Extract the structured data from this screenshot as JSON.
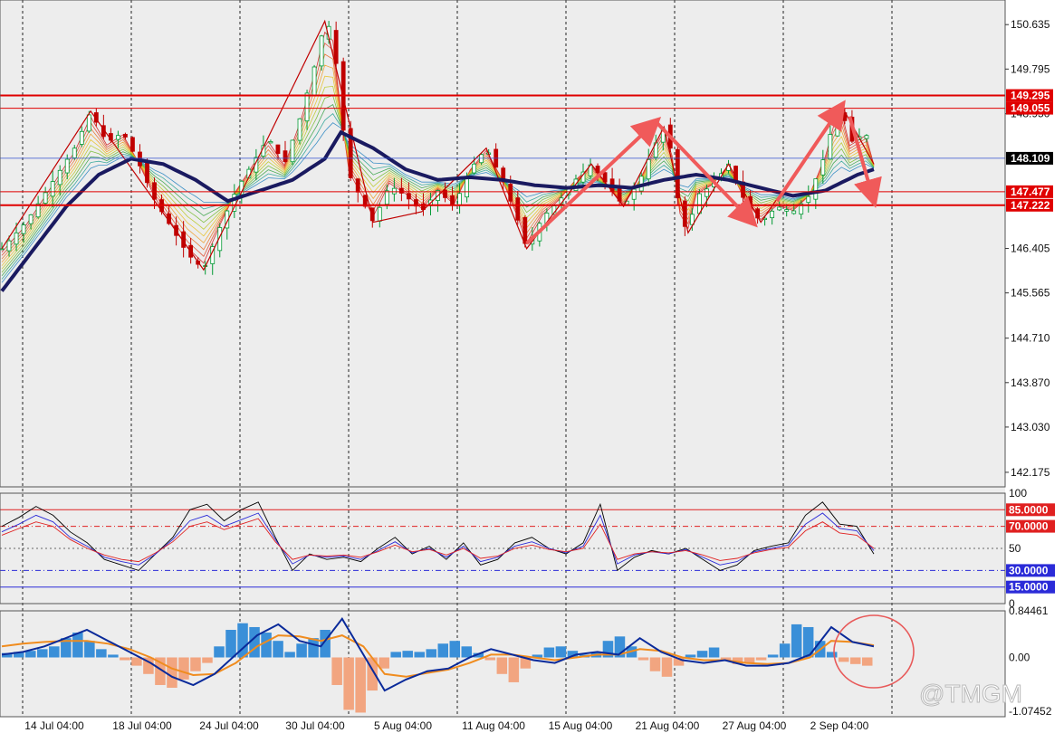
{
  "colors": {
    "background": "#ededed",
    "panel_bg": "#ffffff",
    "candle_red": "#c00000",
    "candle_green": "#009933",
    "ma_slow": "#1a1a60",
    "resistance": "#e00000",
    "annotation_arrow": "#f05a5a",
    "current_price_tag": "#000000",
    "macd_pos": "#3a8fd8",
    "macd_neg": "#f2a580",
    "macd_line": "#0a2a9a",
    "signal_line": "#f08c1e",
    "rsi_black": "#000000",
    "rsi_blue": "#2b2bd8",
    "rsi_red": "#e02020"
  },
  "chart_data": [
    {
      "type": "candlestick",
      "title": "",
      "x_labels": [
        "14 Jul 04:00",
        "18 Jul 04:00",
        "24 Jul 04:00",
        "30 Jul 04:00",
        "5 Aug 04:00",
        "11 Aug 04:00",
        "15 Aug 04:00",
        "21 Aug 04:00",
        "27 Aug 04:00",
        "2 Sep 04:00"
      ],
      "y_ticks": [
        "150.635",
        "149.795",
        "148.950",
        "146.405",
        "145.565",
        "144.710",
        "143.870",
        "143.030",
        "142.175"
      ],
      "ylim": [
        141.9,
        151.1
      ],
      "price_path": [
        {
          "x": 0,
          "y": 146.4
        },
        {
          "x": 3,
          "y": 146.9
        },
        {
          "x": 6,
          "y": 147.6
        },
        {
          "x": 9,
          "y": 148.3
        },
        {
          "x": 11,
          "y": 149.0
        },
        {
          "x": 13,
          "y": 148.4
        },
        {
          "x": 15,
          "y": 148.6
        },
        {
          "x": 17,
          "y": 148.0
        },
        {
          "x": 19,
          "y": 147.3
        },
        {
          "x": 21,
          "y": 146.8
        },
        {
          "x": 23,
          "y": 146.3
        },
        {
          "x": 25,
          "y": 146.0
        },
        {
          "x": 27,
          "y": 146.8
        },
        {
          "x": 29,
          "y": 147.5
        },
        {
          "x": 31,
          "y": 148.0
        },
        {
          "x": 33,
          "y": 148.5
        },
        {
          "x": 35,
          "y": 148.0
        },
        {
          "x": 37,
          "y": 148.9
        },
        {
          "x": 39,
          "y": 150.0
        },
        {
          "x": 40,
          "y": 150.7
        },
        {
          "x": 41,
          "y": 150.5
        },
        {
          "x": 42,
          "y": 149.0
        },
        {
          "x": 43,
          "y": 147.8
        },
        {
          "x": 45,
          "y": 147.2
        },
        {
          "x": 46,
          "y": 146.9
        },
        {
          "x": 48,
          "y": 147.6
        },
        {
          "x": 50,
          "y": 147.4
        },
        {
          "x": 52,
          "y": 147.1
        },
        {
          "x": 54,
          "y": 147.5
        },
        {
          "x": 56,
          "y": 147.2
        },
        {
          "x": 58,
          "y": 147.9
        },
        {
          "x": 60,
          "y": 148.3
        },
        {
          "x": 62,
          "y": 147.7
        },
        {
          "x": 64,
          "y": 146.9
        },
        {
          "x": 65,
          "y": 146.4
        },
        {
          "x": 67,
          "y": 147.0
        },
        {
          "x": 69,
          "y": 147.3
        },
        {
          "x": 71,
          "y": 147.7
        },
        {
          "x": 73,
          "y": 148.0
        },
        {
          "x": 75,
          "y": 147.6
        },
        {
          "x": 77,
          "y": 147.2
        },
        {
          "x": 79,
          "y": 147.7
        },
        {
          "x": 81,
          "y": 148.4
        },
        {
          "x": 82,
          "y": 148.7
        },
        {
          "x": 83,
          "y": 148.2
        },
        {
          "x": 84,
          "y": 147.0
        },
        {
          "x": 85,
          "y": 146.7
        },
        {
          "x": 86,
          "y": 147.4
        },
        {
          "x": 88,
          "y": 147.6
        },
        {
          "x": 90,
          "y": 148.0
        },
        {
          "x": 92,
          "y": 147.3
        },
        {
          "x": 94,
          "y": 146.9
        },
        {
          "x": 96,
          "y": 147.2
        },
        {
          "x": 98,
          "y": 147.1
        },
        {
          "x": 100,
          "y": 147.4
        },
        {
          "x": 102,
          "y": 148.2
        },
        {
          "x": 103,
          "y": 148.8
        },
        {
          "x": 104,
          "y": 149.1
        },
        {
          "x": 105,
          "y": 148.4
        },
        {
          "x": 107,
          "y": 148.6
        },
        {
          "x": 108,
          "y": 148.0
        }
      ],
      "moving_average": [
        {
          "x": 0,
          "y": 145.6
        },
        {
          "x": 4,
          "y": 146.4
        },
        {
          "x": 8,
          "y": 147.2
        },
        {
          "x": 12,
          "y": 147.8
        },
        {
          "x": 16,
          "y": 148.1
        },
        {
          "x": 20,
          "y": 148.0
        },
        {
          "x": 24,
          "y": 147.7
        },
        {
          "x": 28,
          "y": 147.3
        },
        {
          "x": 32,
          "y": 147.5
        },
        {
          "x": 36,
          "y": 147.7
        },
        {
          "x": 40,
          "y": 148.1
        },
        {
          "x": 42,
          "y": 148.6
        },
        {
          "x": 46,
          "y": 148.3
        },
        {
          "x": 50,
          "y": 147.9
        },
        {
          "x": 54,
          "y": 147.7
        },
        {
          "x": 58,
          "y": 147.75
        },
        {
          "x": 62,
          "y": 147.7
        },
        {
          "x": 66,
          "y": 147.6
        },
        {
          "x": 70,
          "y": 147.55
        },
        {
          "x": 74,
          "y": 147.6
        },
        {
          "x": 78,
          "y": 147.55
        },
        {
          "x": 82,
          "y": 147.7
        },
        {
          "x": 86,
          "y": 147.8
        },
        {
          "x": 90,
          "y": 147.7
        },
        {
          "x": 94,
          "y": 147.55
        },
        {
          "x": 98,
          "y": 147.4
        },
        {
          "x": 102,
          "y": 147.5
        },
        {
          "x": 106,
          "y": 147.8
        },
        {
          "x": 108,
          "y": 147.9
        }
      ],
      "horizontal_levels": [
        {
          "price": 149.295,
          "label": "149.295",
          "style": "thick"
        },
        {
          "price": 149.055,
          "label": "149.055",
          "style": "thin"
        },
        {
          "price": 147.477,
          "label": "147.477",
          "style": "thin"
        },
        {
          "price": 147.222,
          "label": "147.222",
          "style": "thick"
        }
      ],
      "current_price": {
        "price": 148.109,
        "label": "148.109"
      },
      "annotations": [
        {
          "from": [
            65,
            146.5
          ],
          "to": [
            81,
            148.8
          ]
        },
        {
          "from": [
            81,
            148.8
          ],
          "to": [
            93,
            146.9
          ]
        },
        {
          "from": [
            96,
            147.3
          ],
          "to": [
            104,
            149.1
          ]
        },
        {
          "from": [
            105,
            148.9
          ],
          "to": [
            108,
            147.3
          ]
        }
      ]
    },
    {
      "type": "line",
      "title": "",
      "ylim": [
        0,
        100
      ],
      "y_ticks": [
        "100",
        "50",
        "0"
      ],
      "levels": [
        {
          "value": 85,
          "label": "85.0000",
          "color": "#e02020"
        },
        {
          "value": 70,
          "label": "70.0000",
          "color": "#e02020"
        },
        {
          "value": 30,
          "label": "30.0000",
          "color": "#2b2bd8"
        },
        {
          "value": 15,
          "label": "15.0000",
          "color": "#2b2bd8"
        }
      ],
      "series": [
        {
          "values": [
            70,
            78,
            88,
            80,
            65,
            55,
            40,
            35,
            30,
            45,
            60,
            85,
            90,
            75,
            85,
            92,
            60,
            30,
            45,
            40,
            42,
            38,
            50,
            60,
            45,
            52,
            40,
            55,
            35,
            40,
            55,
            60,
            50,
            45,
            55,
            90,
            30,
            42,
            48,
            45,
            50,
            40,
            30,
            35,
            48,
            52,
            55,
            80,
            92,
            72,
            70,
            45
          ]
        },
        {
          "values": [
            65,
            72,
            80,
            74,
            60,
            52,
            42,
            38,
            35,
            45,
            58,
            75,
            80,
            70,
            76,
            82,
            58,
            36,
            44,
            42,
            43,
            40,
            48,
            56,
            46,
            50,
            42,
            52,
            38,
            42,
            52,
            56,
            50,
            46,
            52,
            80,
            36,
            44,
            47,
            45,
            49,
            42,
            35,
            38,
            47,
            50,
            53,
            72,
            82,
            68,
            66,
            48
          ]
        },
        {
          "values": [
            62,
            68,
            74,
            70,
            58,
            50,
            44,
            40,
            38,
            46,
            56,
            70,
            74,
            67,
            72,
            77,
            56,
            40,
            44,
            43,
            44,
            42,
            47,
            53,
            47,
            49,
            44,
            50,
            41,
            43,
            50,
            53,
            49,
            47,
            50,
            72,
            40,
            45,
            47,
            46,
            48,
            44,
            39,
            41,
            46,
            49,
            51,
            66,
            74,
            64,
            62,
            50
          ]
        }
      ]
    },
    {
      "type": "bar",
      "title": "",
      "y_ticks": [
        "0.84461",
        "0.00",
        "-1.07452"
      ],
      "ylim": [
        -1.07452,
        0.84461
      ],
      "values": [
        0.08,
        0.1,
        0.12,
        0.15,
        0.2,
        0.35,
        0.45,
        0.3,
        0.15,
        0.05,
        -0.05,
        -0.15,
        -0.3,
        -0.5,
        -0.55,
        -0.4,
        -0.25,
        -0.1,
        0.2,
        0.5,
        0.62,
        0.55,
        0.45,
        0.3,
        0.1,
        0.25,
        0.35,
        0.5,
        -0.5,
        -0.95,
        -1.0,
        -0.6,
        -0.2,
        0.1,
        0.12,
        0.1,
        0.15,
        0.25,
        0.3,
        0.2,
        0.08,
        -0.05,
        -0.3,
        -0.45,
        -0.2,
        0.05,
        0.18,
        0.2,
        0.12,
        0.05,
        0.1,
        0.3,
        0.38,
        0.2,
        -0.05,
        -0.25,
        -0.35,
        -0.15,
        0.05,
        0.12,
        0.18,
        -0.05,
        -0.12,
        -0.1,
        -0.05,
        0.05,
        0.25,
        0.6,
        0.55,
        0.3,
        0.1,
        -0.08,
        -0.12,
        -0.15
      ],
      "macd_line": [
        0.05,
        0.1,
        0.2,
        0.35,
        0.5,
        0.3,
        0.1,
        -0.1,
        -0.35,
        -0.5,
        -0.3,
        0.05,
        0.4,
        0.6,
        0.3,
        0.2,
        0.7,
        0.05,
        -0.6,
        -0.4,
        -0.25,
        -0.2,
        0.0,
        0.15,
        0.05,
        -0.05,
        -0.1,
        0.05,
        0.1,
        0.05,
        0.35,
        0.1,
        -0.05,
        -0.1,
        -0.05,
        -0.15,
        -0.15,
        -0.1,
        0.05,
        0.55,
        0.28,
        0.2
      ],
      "signal_line": [
        0.2,
        0.25,
        0.28,
        0.3,
        0.3,
        0.25,
        0.15,
        0.0,
        -0.2,
        -0.32,
        -0.3,
        -0.1,
        0.2,
        0.4,
        0.38,
        0.3,
        0.4,
        0.2,
        -0.3,
        -0.35,
        -0.28,
        -0.22,
        -0.1,
        0.05,
        0.05,
        0.0,
        -0.05,
        0.0,
        0.05,
        0.05,
        0.15,
        0.12,
        0.0,
        -0.05,
        -0.05,
        -0.1,
        -0.12,
        -0.1,
        0.0,
        0.3,
        0.28,
        0.22
      ]
    }
  ],
  "watermark": "@TMGM"
}
